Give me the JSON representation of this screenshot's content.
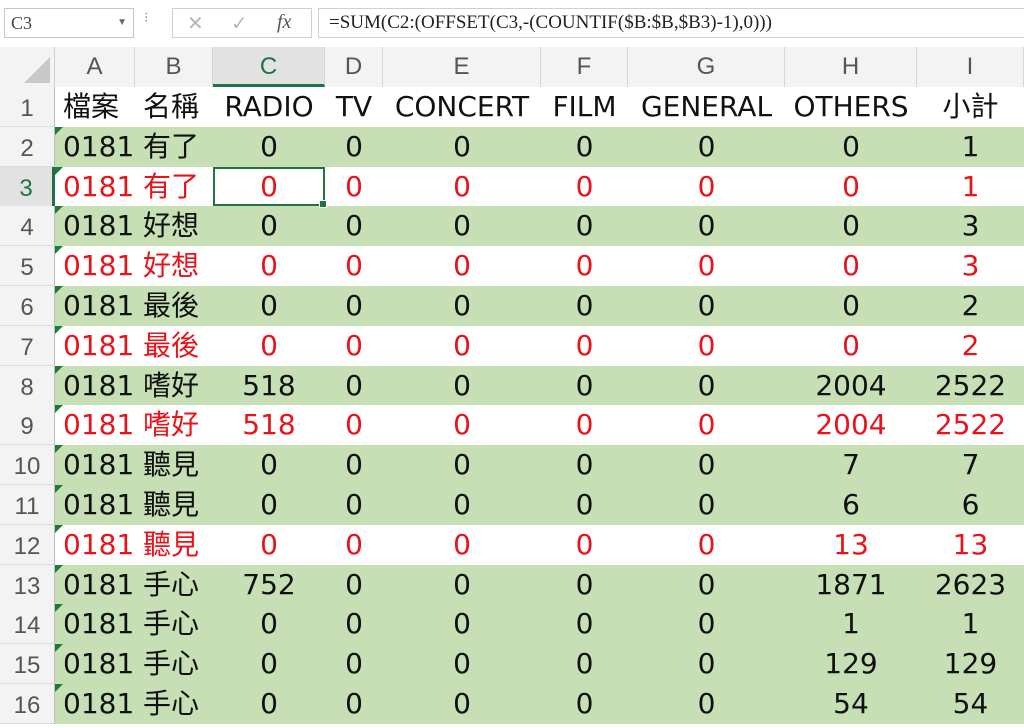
{
  "name_box": "C3",
  "formula": "=SUM(C2:(OFFSET(C3,-(COUNTIF($B:$B,$B3)-1),0)))",
  "icons": {
    "cancel": "close-icon",
    "enter": "check-icon",
    "function": "fx-icon"
  },
  "columns": [
    "A",
    "B",
    "C",
    "D",
    "E",
    "F",
    "G",
    "H",
    "I"
  ],
  "active_column": "C",
  "active_row": "3",
  "colors": {
    "green_fill": "#c6dfb4",
    "red_text": "#e8141b",
    "excel_green": "#217346"
  },
  "rows": [
    {
      "num": "1",
      "style": "hdr",
      "cells": [
        "檔案",
        "名稱",
        "RADIO",
        "TV",
        "CONCERT",
        "FILM",
        "GENERAL",
        "OTHERS",
        "小計"
      ]
    },
    {
      "num": "2",
      "style": "green",
      "cells": [
        "0181",
        "有了",
        "0",
        "0",
        "0",
        "0",
        "0",
        "0",
        "1"
      ]
    },
    {
      "num": "3",
      "style": "red",
      "cells": [
        "0181",
        "有了",
        "0",
        "0",
        "0",
        "0",
        "0",
        "0",
        "1"
      ]
    },
    {
      "num": "4",
      "style": "green",
      "cells": [
        "0181",
        "好想",
        "0",
        "0",
        "0",
        "0",
        "0",
        "0",
        "3"
      ]
    },
    {
      "num": "5",
      "style": "red",
      "cells": [
        "0181",
        "好想",
        "0",
        "0",
        "0",
        "0",
        "0",
        "0",
        "3"
      ]
    },
    {
      "num": "6",
      "style": "green",
      "cells": [
        "0181",
        "最後",
        "0",
        "0",
        "0",
        "0",
        "0",
        "0",
        "2"
      ]
    },
    {
      "num": "7",
      "style": "red",
      "cells": [
        "0181",
        "最後",
        "0",
        "0",
        "0",
        "0",
        "0",
        "0",
        "2"
      ]
    },
    {
      "num": "8",
      "style": "green",
      "cells": [
        "0181",
        "嗜好",
        "518",
        "0",
        "0",
        "0",
        "0",
        "2004",
        "2522"
      ]
    },
    {
      "num": "9",
      "style": "red",
      "cells": [
        "0181",
        "嗜好",
        "518",
        "0",
        "0",
        "0",
        "0",
        "2004",
        "2522"
      ]
    },
    {
      "num": "10",
      "style": "green",
      "cells": [
        "0181",
        "聽見",
        "0",
        "0",
        "0",
        "0",
        "0",
        "7",
        "7"
      ]
    },
    {
      "num": "11",
      "style": "green",
      "cells": [
        "0181",
        "聽見",
        "0",
        "0",
        "0",
        "0",
        "0",
        "6",
        "6"
      ]
    },
    {
      "num": "12",
      "style": "red",
      "cells": [
        "0181",
        "聽見",
        "0",
        "0",
        "0",
        "0",
        "0",
        "13",
        "13"
      ]
    },
    {
      "num": "13",
      "style": "green",
      "cells": [
        "0181",
        "手心",
        "752",
        "0",
        "0",
        "0",
        "0",
        "1871",
        "2623"
      ]
    },
    {
      "num": "14",
      "style": "green",
      "cells": [
        "0181",
        "手心",
        "0",
        "0",
        "0",
        "0",
        "0",
        "1",
        "1"
      ]
    },
    {
      "num": "15",
      "style": "green",
      "cells": [
        "0181",
        "手心",
        "0",
        "0",
        "0",
        "0",
        "0",
        "129",
        "129"
      ]
    },
    {
      "num": "16",
      "style": "green",
      "cells": [
        "0181",
        "手心",
        "0",
        "0",
        "0",
        "0",
        "0",
        "54",
        "54"
      ]
    }
  ]
}
